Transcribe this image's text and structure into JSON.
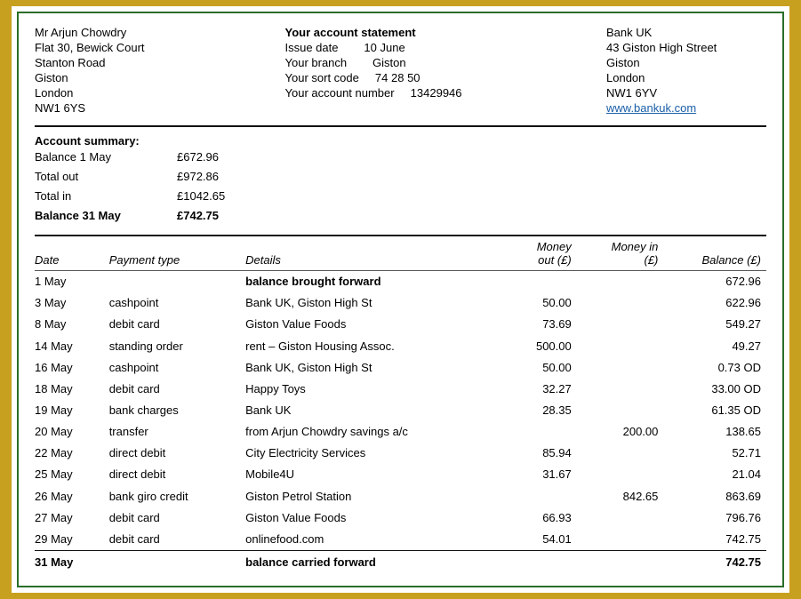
{
  "header": {
    "customer": {
      "name": "Mr Arjun Chowdry",
      "address1": "Flat 30, Bewick Court",
      "address2": "Stanton Road",
      "address3": "Giston",
      "address4": "London",
      "address5": "NW1 6YS"
    },
    "statement": {
      "title": "Your account statement",
      "issue_label": "Issue date",
      "issue_value": "10 June",
      "branch_label": "Your branch",
      "branch_value": "Giston",
      "sortcode_label": "Your sort code",
      "sortcode_value": "74 28 50",
      "account_label": "Your account number",
      "account_value": "13429946"
    },
    "bank": {
      "name": "Bank UK",
      "address1": "43 Giston High Street",
      "address2": "Giston",
      "address3": "London",
      "address4": "NW1 6YV",
      "website": "www.bankuk.com"
    }
  },
  "summary": {
    "title": "Account summary:",
    "rows": [
      {
        "label": "Balance 1 May",
        "value": "£672.96"
      },
      {
        "label": "Total out",
        "value": "£972.86"
      },
      {
        "label": "Total in",
        "value": "£1042.65"
      },
      {
        "label": "Balance 31 May",
        "value": "£742.75",
        "bold": true
      }
    ]
  },
  "table": {
    "headers": {
      "date": "Date",
      "payment_type": "Payment type",
      "details": "Details",
      "money_out": "Money out (£)",
      "money_in": "Money in (£)",
      "balance": "Balance (£)"
    },
    "rows": [
      {
        "date": "1 May",
        "type": "",
        "details": "balance brought forward",
        "money_out": "",
        "money_in": "",
        "balance": "672.96",
        "bold_details": true
      },
      {
        "date": "3 May",
        "type": "cashpoint",
        "details": "Bank UK, Giston High St",
        "money_out": "50.00",
        "money_in": "",
        "balance": "622.96",
        "bold_details": false
      },
      {
        "date": "8 May",
        "type": "debit card",
        "details": "Giston Value Foods",
        "money_out": "73.69",
        "money_in": "",
        "balance": "549.27",
        "bold_details": false
      },
      {
        "date": "14 May",
        "type": "standing order",
        "details": "rent – Giston Housing Assoc.",
        "money_out": "500.00",
        "money_in": "",
        "balance": "49.27",
        "bold_details": false
      },
      {
        "date": "16 May",
        "type": "cashpoint",
        "details": "Bank UK, Giston High St",
        "money_out": "50.00",
        "money_in": "",
        "balance": "0.73 OD",
        "bold_details": false
      },
      {
        "date": "18 May",
        "type": "debit card",
        "details": "Happy Toys",
        "money_out": "32.27",
        "money_in": "",
        "balance": "33.00 OD",
        "bold_details": false
      },
      {
        "date": "19 May",
        "type": "bank charges",
        "details": "Bank UK",
        "money_out": "28.35",
        "money_in": "",
        "balance": "61.35 OD",
        "bold_details": false
      },
      {
        "date": "20 May",
        "type": "transfer",
        "details": "from Arjun Chowdry savings a/c",
        "money_out": "",
        "money_in": "200.00",
        "balance": "138.65",
        "bold_details": false
      },
      {
        "date": "22 May",
        "type": "direct debit",
        "details": "City Electricity Services",
        "money_out": "85.94",
        "money_in": "",
        "balance": "52.71",
        "bold_details": false
      },
      {
        "date": "25 May",
        "type": "direct debit",
        "details": "Mobile4U",
        "money_out": "31.67",
        "money_in": "",
        "balance": "21.04",
        "bold_details": false
      },
      {
        "date": "26 May",
        "type": "bank giro credit",
        "details": "Giston Petrol Station",
        "money_out": "",
        "money_in": "842.65",
        "balance": "863.69",
        "bold_details": false
      },
      {
        "date": "27 May",
        "type": "debit card",
        "details": "Giston Value Foods",
        "money_out": "66.93",
        "money_in": "",
        "balance": "796.76",
        "bold_details": false
      },
      {
        "date": "29 May",
        "type": "debit card",
        "details": "onlinefood.com",
        "money_out": "54.01",
        "money_in": "",
        "balance": "742.75",
        "bold_details": false
      },
      {
        "date": "31 May",
        "type": "",
        "details": "balance carried forward",
        "money_out": "",
        "money_in": "",
        "balance": "742.75",
        "bold_details": true,
        "last": true
      }
    ]
  }
}
